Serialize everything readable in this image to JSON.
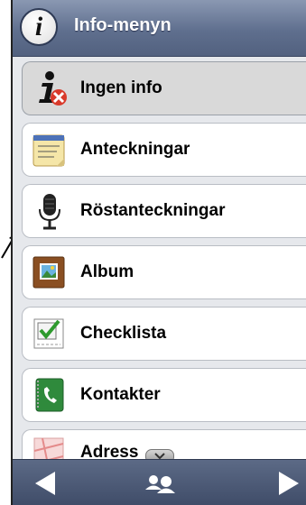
{
  "header": {
    "title": "Info-menyn",
    "badge_letter": "i",
    "badge_icon": "info-icon"
  },
  "menu": {
    "items": [
      {
        "label": "Ingen info",
        "icon": "no-info-icon",
        "selected": true
      },
      {
        "label": "Anteckningar",
        "icon": "notepad-icon",
        "selected": false
      },
      {
        "label": "Röstanteckningar",
        "icon": "microphone-icon",
        "selected": false
      },
      {
        "label": "Album",
        "icon": "photo-album-icon",
        "selected": false
      },
      {
        "label": "Checklista",
        "icon": "checklist-icon",
        "selected": false
      },
      {
        "label": "Kontakter",
        "icon": "phone-contacts-icon",
        "selected": false
      },
      {
        "label": "Adress",
        "icon": "map-icon",
        "selected": false
      }
    ],
    "more_icon": "chevron-down-icon"
  },
  "navbar": {
    "prev_icon": "triangle-left-icon",
    "center_icon": "people-icon",
    "next_icon": "triangle-right-icon"
  },
  "colors": {
    "header_top": "#8a98b2",
    "header_bottom": "#52617f",
    "navbar": "#4a5773",
    "selected_row": "#d9d9d9"
  }
}
